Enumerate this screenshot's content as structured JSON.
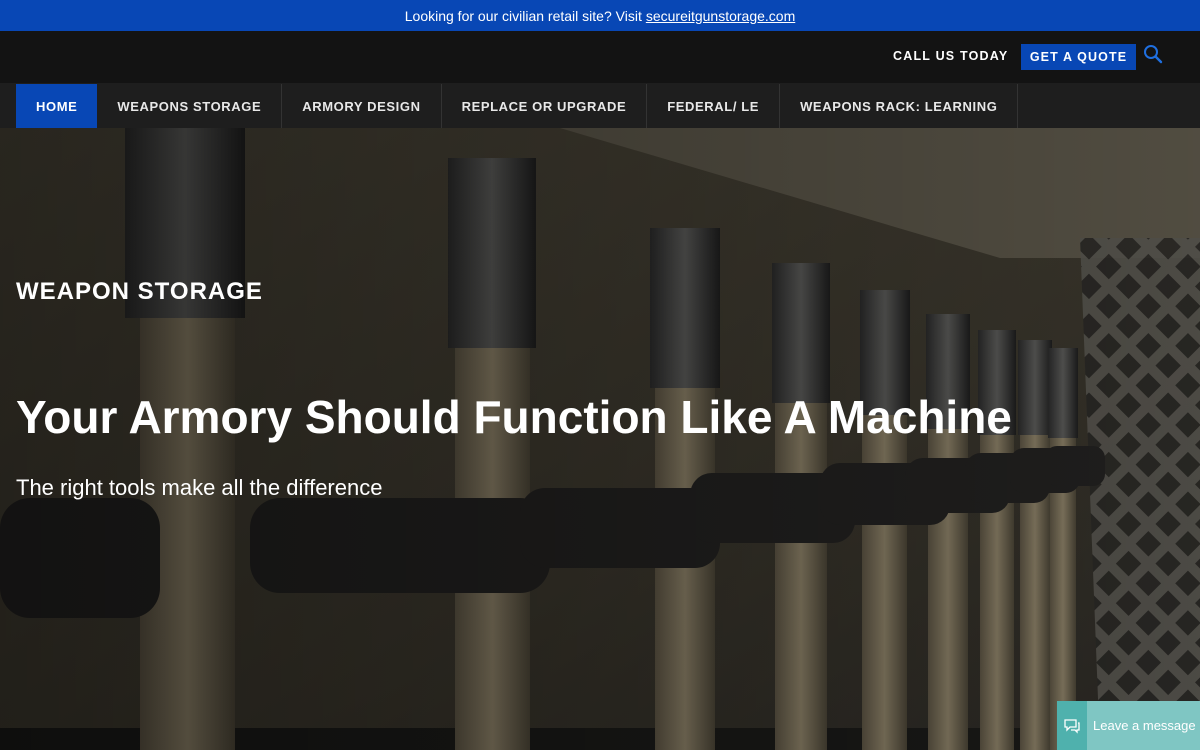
{
  "announcement": {
    "text": "Looking for our civilian retail site? Visit",
    "link_text": "secureitgunstorage.com"
  },
  "topbar": {
    "call_label": "CALL US TODAY",
    "quote_label": "GET A QUOTE",
    "search_icon": "search-icon"
  },
  "nav": {
    "items": [
      {
        "label": "HOME",
        "active": true
      },
      {
        "label": "WEAPONS STORAGE",
        "active": false
      },
      {
        "label": "ARMORY DESIGN",
        "active": false
      },
      {
        "label": "REPLACE OR UPGRADE",
        "active": false
      },
      {
        "label": "FEDERAL/ LE",
        "active": false
      },
      {
        "label": "WEAPONS RACK: LEARNING",
        "active": false
      }
    ]
  },
  "hero": {
    "eyebrow": "WEAPON STORAGE",
    "headline": "Your Armory Should Function Like A Machine",
    "subline": "The right tools make all the difference"
  },
  "chat": {
    "label": "Leave a message",
    "icon": "chat-bubble-icon"
  },
  "colors": {
    "brand_blue": "#0847b5",
    "topbar_bg": "#131313",
    "nav_bg": "#1e1e1e",
    "chat_teal": "#7fc6c3"
  }
}
